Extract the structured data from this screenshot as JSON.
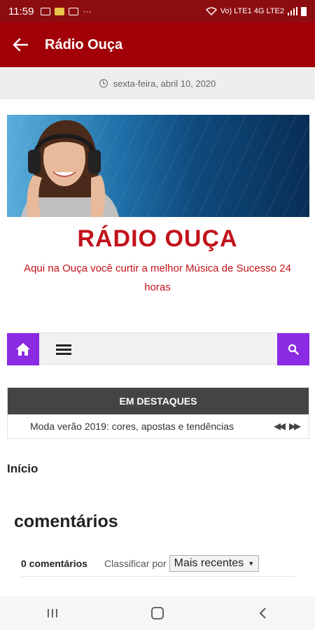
{
  "status_bar": {
    "time": "11:59",
    "dots": "···",
    "network": "Vo) LTE1 4G LTE2"
  },
  "app_bar": {
    "title": "Rádio Ouça"
  },
  "date_bar": {
    "date": "sexta-feira, abril 10, 2020"
  },
  "site": {
    "title": "RÁDIO OUÇA",
    "tagline": "Aqui na Ouça você curtir a melhor Música de Sucesso 24 horas"
  },
  "featured": {
    "header": "EM DESTAQUES",
    "headline": "Moda verão 2019: cores, apostas e tendências",
    "prev_glyph": "◀◀",
    "next_glyph": "▶▶"
  },
  "breadcrumb": {
    "label": "Início"
  },
  "comments": {
    "title": "comentários",
    "count": "0 comentários",
    "sort_label": "Classificar por",
    "sort_value": "Mais recentes"
  },
  "colors": {
    "header": "#a10006",
    "status_bar": "#8c0d10",
    "accent": "#8a2be2",
    "site_title": "#c1121b"
  }
}
